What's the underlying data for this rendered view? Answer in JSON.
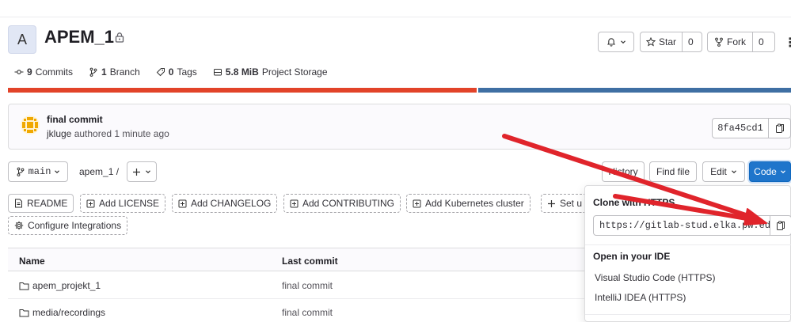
{
  "project": {
    "avatar_letter": "A",
    "name": "APEM_1"
  },
  "header_actions": {
    "star_label": "Star",
    "star_count": "0",
    "fork_label": "Fork",
    "fork_count": "0",
    "more": "⋮"
  },
  "stats": {
    "commits_count": "9",
    "commits_label": "Commits",
    "branches_count": "1",
    "branches_label": "Branch",
    "tags_count": "0",
    "tags_label": "Tags",
    "storage_value": "5.8 MiB",
    "storage_label": "Project Storage"
  },
  "language_bar": {
    "colors": [
      "#e24329",
      "#3f6fa3"
    ],
    "split_fraction": 0.6
  },
  "last_commit": {
    "message": "final commit",
    "author": "jkluge",
    "authored_text": "authored 1 minute ago",
    "sha": "8fa45cd1"
  },
  "repo_toolbar": {
    "branch": "main",
    "path": "apem_1",
    "path_sep": "/",
    "history_label": "History",
    "find_file_label": "Find file",
    "edit_label": "Edit",
    "code_label": "Code"
  },
  "quick_actions": {
    "readme": "README",
    "add_license": "Add LICENSE",
    "add_changelog": "Add CHANGELOG",
    "add_contributing": "Add CONTRIBUTING",
    "add_k8s": "Add Kubernetes cluster",
    "setup_ci": "Set u",
    "configure_integrations": "Configure Integrations"
  },
  "table": {
    "col_name": "Name",
    "col_last_commit": "Last commit",
    "rows": [
      {
        "name": "apem_projekt_1",
        "commit": "final commit"
      },
      {
        "name": "media/recordings",
        "commit": "final commit"
      }
    ]
  },
  "clone_dropdown": {
    "clone_https_heading": "Clone with HTTPS",
    "https_url": "https://gitlab-stud.elka.pw.edu",
    "ide_heading": "Open in your IDE",
    "vscode_https": "Visual Studio Code (HTTPS)",
    "intellij_https": "IntelliJ IDEA (HTTPS)"
  },
  "colors": {
    "accent": "#1f75cb",
    "annotation_arrow": "#e0242b"
  }
}
